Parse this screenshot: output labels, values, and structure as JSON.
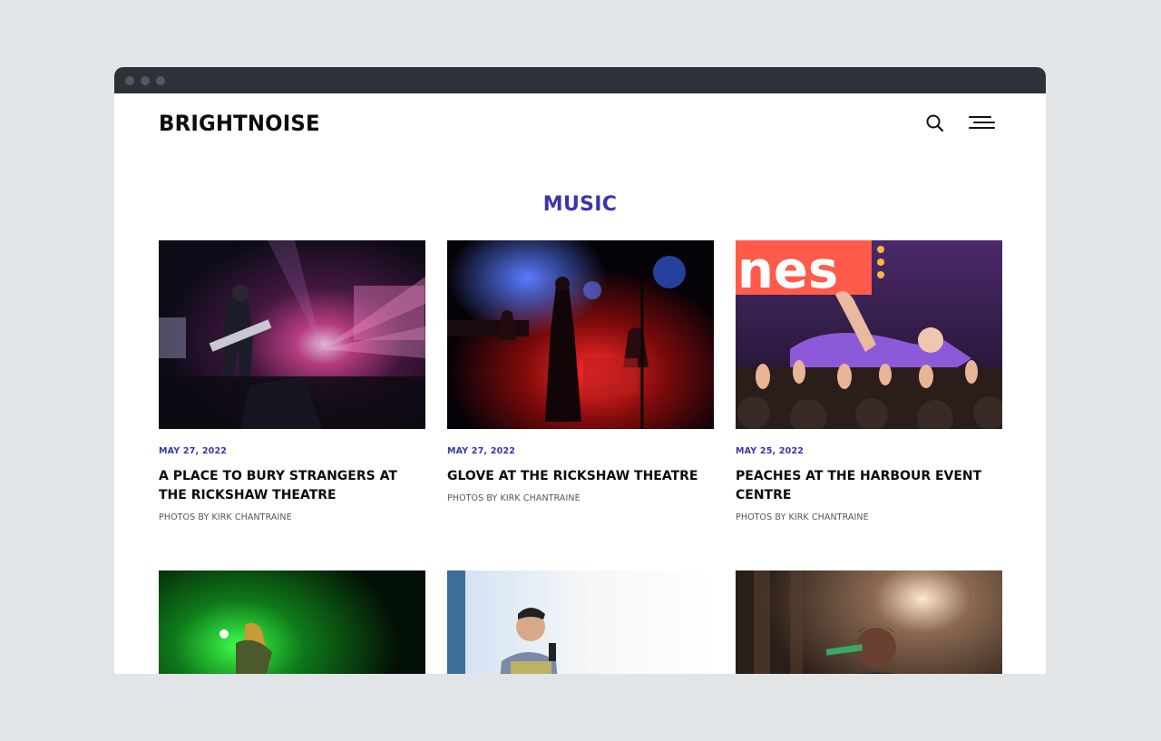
{
  "site": {
    "logo": "BRIGHTNOISE",
    "search_icon": "search-icon",
    "menu_icon": "hamburger-menu-icon"
  },
  "section": {
    "title": "MUSIC"
  },
  "articles": [
    {
      "date": "MAY 27, 2022",
      "title": "A PLACE TO BURY STRANGERS AT THE RICKSHAW THEATRE",
      "byline": "PHOTOS BY KIRK CHANTRAINE"
    },
    {
      "date": "MAY 27, 2022",
      "title": "GLOVE AT THE RICKSHAW THEATRE",
      "byline": "PHOTOS BY KIRK CHANTRAINE"
    },
    {
      "date": "MAY 25, 2022",
      "title": "PEACHES AT THE HARBOUR EVENT CENTRE",
      "byline": "PHOTOS BY KIRK CHANTRAINE"
    }
  ],
  "colors": {
    "accent": "#3a35a8",
    "titlebar": "#2b3239",
    "page_background": "#e1e5e8"
  }
}
